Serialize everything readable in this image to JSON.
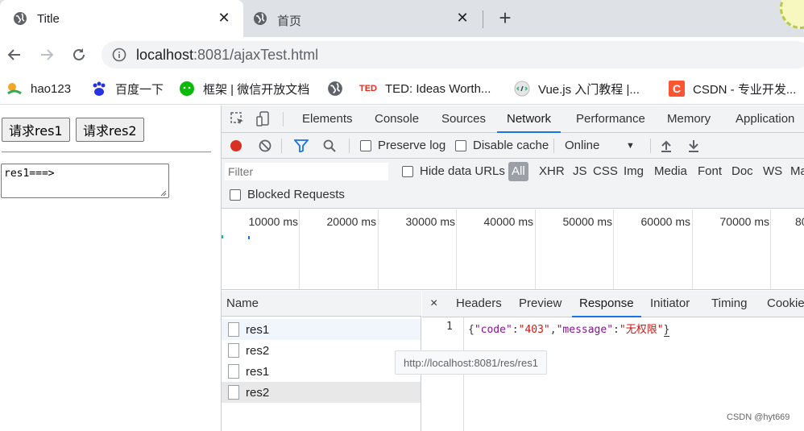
{
  "browser": {
    "tabs": [
      {
        "title": "Title",
        "close": "✕"
      },
      {
        "title": "首页",
        "close": "✕"
      }
    ],
    "new_tab": "+",
    "url_host": "localhost",
    "url_rest": ":8081/ajaxTest.html"
  },
  "bookmarks": [
    {
      "label": "hao123",
      "icon": "hao123-icon"
    },
    {
      "label": "百度一下",
      "icon": "baidu-icon"
    },
    {
      "label": "框架 | 微信开放文档",
      "icon": "wechat-icon"
    },
    {
      "label": "",
      "icon": "globe-icon"
    },
    {
      "label": "TED: Ideas Worth...",
      "icon": "ted-icon",
      "icon_text": "TED"
    },
    {
      "label": "Vue.js 入门教程 |...",
      "icon": "vue-icon"
    },
    {
      "label": "CSDN - 专业开发...",
      "icon": "csdn-icon",
      "icon_text": "C"
    }
  ],
  "page": {
    "button1": "请求res1",
    "button2": "请求res2",
    "textarea_value": "res1===>"
  },
  "devtools": {
    "tabs": [
      "Elements",
      "Console",
      "Sources",
      "Network",
      "Performance",
      "Memory",
      "Application"
    ],
    "active_tab": "Network",
    "network": {
      "preserve_log": "Preserve log",
      "disable_cache": "Disable cache",
      "throttle": "Online",
      "filter_placeholder": "Filter",
      "hide_data_urls": "Hide data URLs",
      "types": [
        "All",
        "XHR",
        "JS",
        "CSS",
        "Img",
        "Media",
        "Font",
        "Doc",
        "WS",
        "Ma"
      ],
      "blocked_requests": "Blocked Requests",
      "timeline_labels": [
        "10000 ms",
        "20000 ms",
        "30000 ms",
        "40000 ms",
        "50000 ms",
        "60000 ms",
        "70000 ms",
        "80"
      ],
      "name_header": "Name",
      "requests": [
        "res1",
        "res2",
        "res1",
        "res2"
      ],
      "detail_tabs": [
        "Headers",
        "Preview",
        "Response",
        "Initiator",
        "Timing",
        "Cookie"
      ],
      "active_detail_tab": "Response",
      "close": "×",
      "line_number": "1",
      "response_code_key": "\"code\"",
      "response_code_val": "\"403\"",
      "response_msg_key": "\"message\"",
      "response_msg_val": "\"无权限\"",
      "tooltip": "http://localhost:8081/res/res1"
    }
  },
  "watermark": "CSDN @hyt669",
  "colors": {
    "accent": "#1a73e8",
    "record": "#d93025",
    "filter": "#1a73e8"
  }
}
